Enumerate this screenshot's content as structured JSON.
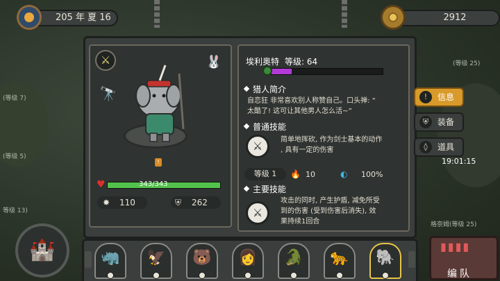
{
  "top_bar": {
    "date": "205 年 夏 16",
    "season_icon": "season-sun-emblem",
    "gold": "2912",
    "gold_icon": "gold-coin-icon"
  },
  "background": {
    "labels": [
      "(等级 7)",
      "(等级 5)",
      "等级 13)",
      "(等级 25)",
      "格奈姆(等级 25)"
    ]
  },
  "hero": {
    "name": "埃利奥特",
    "level_label": "等级: 64",
    "xp_progress": 0.18,
    "hp": "343/343",
    "hp_progress": 1.0,
    "attack": "110",
    "defense": "262"
  },
  "profile": {
    "title": "猎人简介",
    "text_line1": "自恋狂 非常喜欢别人称赞自己。口头禅:  “",
    "text_line2": "太酷了! 这可让其他男人怎么活~”"
  },
  "normal_skill": {
    "title": "普通技能",
    "text_line1": "简单地挥砍, 作为剑士基本的动作",
    "text_line2": ", 具有一定的伤害",
    "level_label": "等级 1",
    "fire_value": "10",
    "crit_value": "100%"
  },
  "main_skill": {
    "title": "主要技能",
    "text_line1": "攻击的同时, 产生护盾, 减免所受",
    "text_line2": "到的伤害 (受到伤害后消失),  效",
    "text_line3": "果持续1回合"
  },
  "tabs": [
    {
      "label": "信息",
      "icon": "info-icon",
      "active": true
    },
    {
      "label": "装备",
      "icon": "shield-icon",
      "active": false
    },
    {
      "label": "道具",
      "icon": "potion-icon",
      "active": false
    }
  ],
  "clock": "19:01:15",
  "roster": [
    {
      "icon": "hero-rhino-portrait",
      "glyph": "🦏"
    },
    {
      "icon": "hero-eagle-portrait",
      "glyph": "🦅"
    },
    {
      "icon": "hero-bear-portrait",
      "glyph": "🐻"
    },
    {
      "icon": "hero-girl-portrait",
      "glyph": "👩"
    },
    {
      "icon": "hero-croc-portrait",
      "glyph": "🐊"
    },
    {
      "icon": "hero-leopard-portrait",
      "glyph": "🐆"
    },
    {
      "icon": "hero-elephant-portrait",
      "glyph": "🐘",
      "selected": true
    }
  ],
  "formation": {
    "label": "编队"
  }
}
